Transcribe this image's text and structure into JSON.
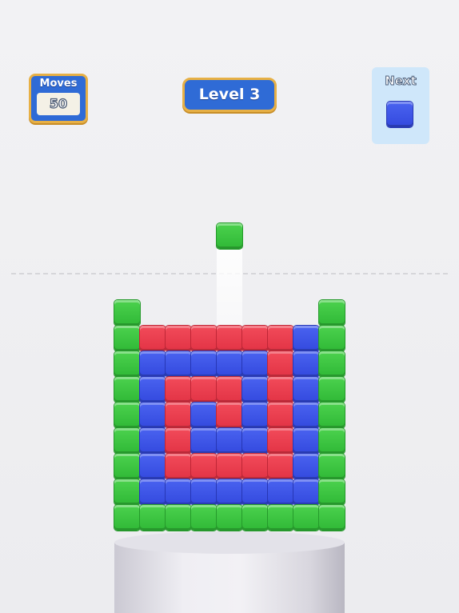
{
  "hud": {
    "moves_label": "Moves",
    "moves_value": "50",
    "level_label": "Level 3",
    "next_label": "Next",
    "next_block_color": "blue"
  },
  "falling_block_color": "green",
  "board": {
    "columns": 9,
    "rows": [
      [
        "green",
        null,
        null,
        null,
        null,
        null,
        null,
        null,
        "green"
      ],
      [
        "green",
        "red",
        "red",
        "red",
        "red",
        "red",
        "red",
        "blue",
        "green"
      ],
      [
        "green",
        "blue",
        "blue",
        "blue",
        "blue",
        "blue",
        "red",
        "blue",
        "green"
      ],
      [
        "green",
        "blue",
        "red",
        "red",
        "red",
        "blue",
        "red",
        "blue",
        "green"
      ],
      [
        "green",
        "blue",
        "red",
        "blue",
        "red",
        "blue",
        "red",
        "blue",
        "green"
      ],
      [
        "green",
        "blue",
        "red",
        "blue",
        "blue",
        "blue",
        "red",
        "blue",
        "green"
      ],
      [
        "green",
        "blue",
        "red",
        "red",
        "red",
        "red",
        "red",
        "blue",
        "green"
      ],
      [
        "green",
        "blue",
        "blue",
        "blue",
        "blue",
        "blue",
        "blue",
        "blue",
        "green"
      ],
      [
        "green",
        "green",
        "green",
        "green",
        "green",
        "green",
        "green",
        "green",
        "green"
      ]
    ]
  },
  "colors": {
    "green": "#3cc43f",
    "red": "#e9404f",
    "blue": "#3c54e6",
    "panel_blue": "#2f6bd6",
    "panel_border": "#e7b045",
    "next_panel_bg": "#cfe7fa"
  }
}
